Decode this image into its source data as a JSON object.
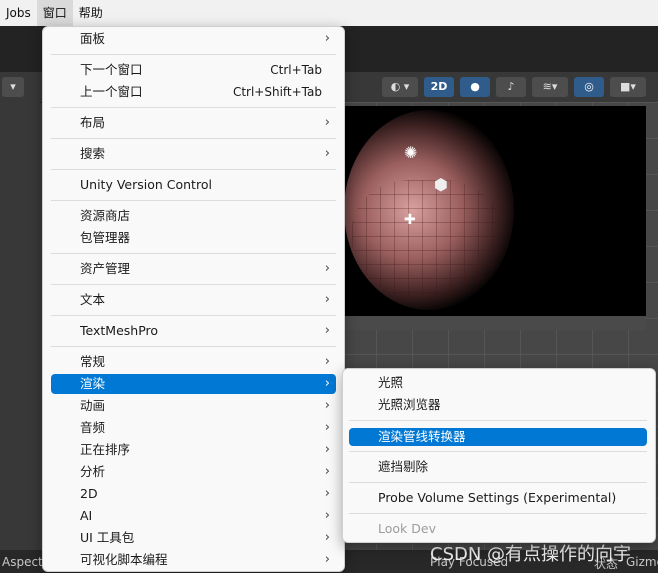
{
  "menubar": {
    "items": [
      {
        "label": "Jobs"
      },
      {
        "label": "窗口"
      },
      {
        "label": "帮助"
      }
    ]
  },
  "toolbar": {
    "view_2d_label": "2D"
  },
  "status": {
    "aspect_label": "Aspect",
    "play_focused_label": "Play Focused",
    "state_label": "状态",
    "gizmos_label": "Gizmo"
  },
  "watermark": "CSDN @有点操作的向宇",
  "window_menu": {
    "items": [
      {
        "label": "面板",
        "has_submenu": true
      },
      {
        "label": "下一个窗口",
        "shortcut": "Ctrl+Tab"
      },
      {
        "label": "上一个窗口",
        "shortcut": "Ctrl+Shift+Tab"
      },
      {
        "label": "布局",
        "has_submenu": true
      },
      {
        "label": "搜索",
        "has_submenu": true
      },
      {
        "label": "Unity Version Control"
      },
      {
        "label": "资源商店"
      },
      {
        "label": "包管理器"
      },
      {
        "label": "资产管理",
        "has_submenu": true
      },
      {
        "label": "文本",
        "has_submenu": true
      },
      {
        "label": "TextMeshPro",
        "has_submenu": true
      },
      {
        "label": "常规",
        "has_submenu": true
      },
      {
        "label": "渲染",
        "has_submenu": true,
        "highlighted": true
      },
      {
        "label": "动画",
        "has_submenu": true
      },
      {
        "label": "音频",
        "has_submenu": true
      },
      {
        "label": "正在排序",
        "has_submenu": true
      },
      {
        "label": "分析",
        "has_submenu": true
      },
      {
        "label": "2D",
        "has_submenu": true
      },
      {
        "label": "AI",
        "has_submenu": true
      },
      {
        "label": "UI 工具包",
        "has_submenu": true
      },
      {
        "label": "可视化脚本编程",
        "has_submenu": true
      }
    ],
    "arrow_glyph": "›"
  },
  "rendering_submenu": {
    "items": [
      {
        "label": "光照"
      },
      {
        "label": "光照浏览器"
      },
      {
        "label": "渲染管线转换器",
        "highlighted": true
      },
      {
        "label": "遮挡剔除"
      },
      {
        "label": "Probe Volume Settings (Experimental)"
      },
      {
        "label": "Look Dev",
        "disabled": true
      }
    ]
  },
  "colors": {
    "highlight": "#0078d4",
    "menu_bg": "#f9f9f9",
    "editor_bg": "#3b3b3b"
  }
}
